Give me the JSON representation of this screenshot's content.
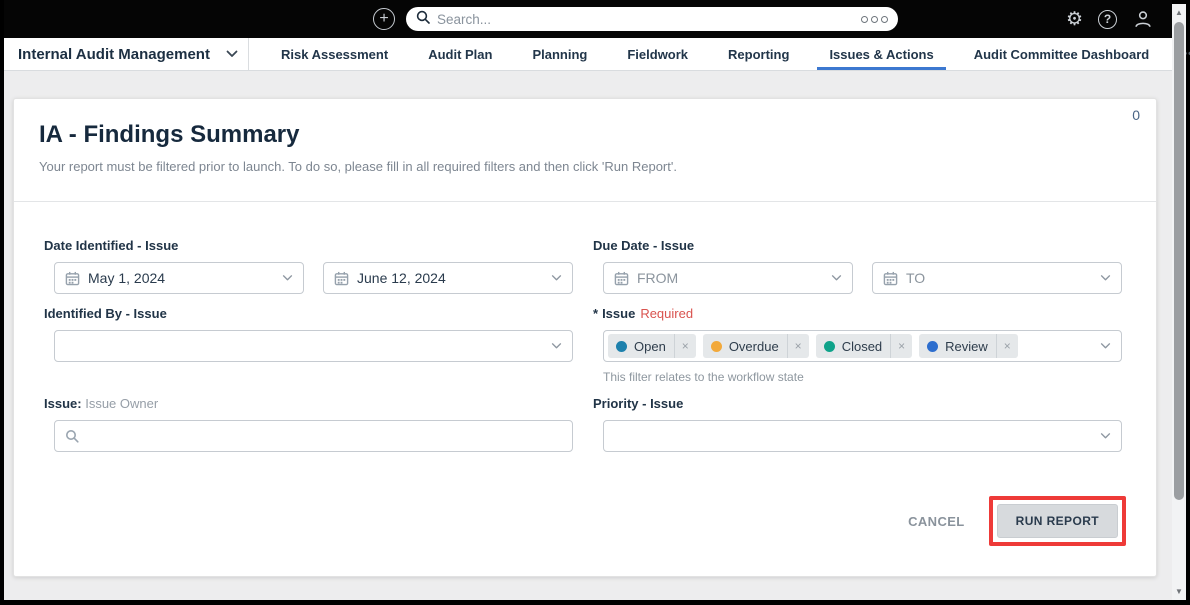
{
  "colors": {
    "accent_blue": "#3c78d0",
    "required_red": "#d9534f",
    "annotation_red": "#ee3a38"
  },
  "topbar": {
    "search_placeholder": "Search..."
  },
  "nav": {
    "app_title": "Internal Audit Management",
    "tabs": [
      {
        "label": "Risk Assessment"
      },
      {
        "label": "Audit Plan"
      },
      {
        "label": "Planning"
      },
      {
        "label": "Fieldwork"
      },
      {
        "label": "Reporting"
      },
      {
        "label": "Issues & Actions"
      },
      {
        "label": "Audit Committee Dashboard"
      }
    ],
    "active_tab": "Issues & Actions",
    "more_label": "•••"
  },
  "panel": {
    "corner_count": "0",
    "title": "IA - Findings Summary",
    "subtitle": "Your report must be filtered prior to launch. To do so, please fill in all required filters and then click 'Run Report'.",
    "filters": {
      "date_identified": {
        "label": "Date Identified - Issue",
        "from_value": "May 1, 2024",
        "to_value": "June 12, 2024"
      },
      "due_date": {
        "label": "Due Date - Issue",
        "from_placeholder": "FROM",
        "to_placeholder": "TO"
      },
      "identified_by": {
        "label": "Identified By - Issue"
      },
      "issue": {
        "required_marker": "*",
        "label": "Issue",
        "required_text": "Required",
        "remove_glyph": "×",
        "help": "This filter relates to the workflow state",
        "tags": [
          {
            "label": "Open",
            "color": "#1d81ad"
          },
          {
            "label": "Overdue",
            "color": "#f2a93b"
          },
          {
            "label": "Closed",
            "color": "#0fa38a"
          },
          {
            "label": "Review",
            "color": "#2d6ece"
          }
        ]
      },
      "issue_owner": {
        "label_prefix": "Issue:",
        "label_suffix": "Issue Owner"
      },
      "priority": {
        "label": "Priority - Issue"
      }
    },
    "footer": {
      "cancel_label": "CANCEL",
      "run_label": "RUN REPORT"
    }
  }
}
